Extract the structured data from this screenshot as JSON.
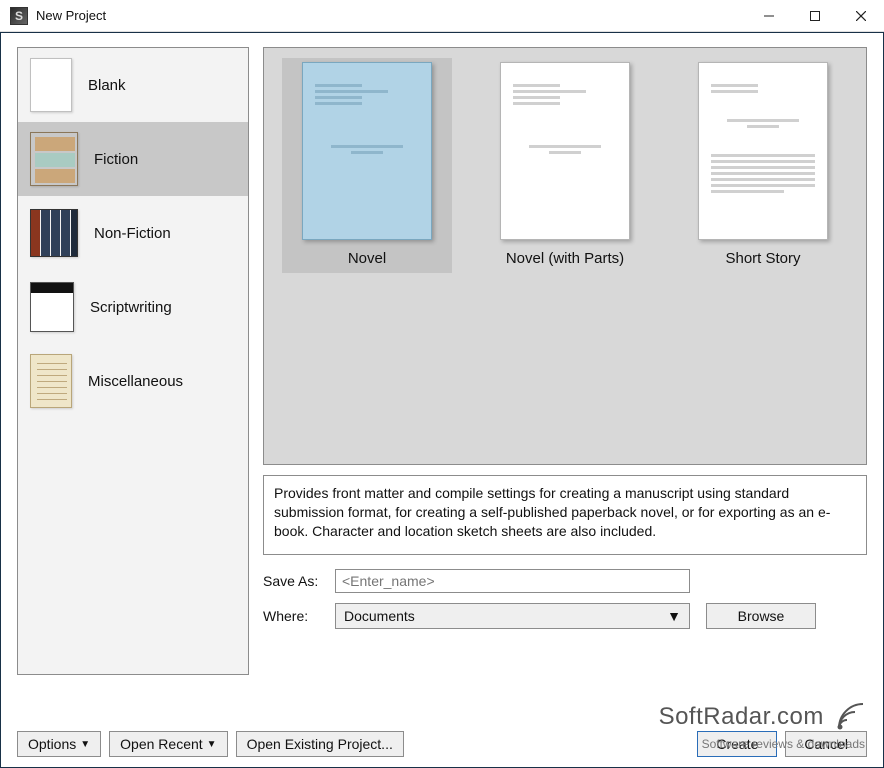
{
  "window": {
    "title": "New Project"
  },
  "categories": {
    "items": [
      {
        "label": "Blank",
        "selected": false,
        "icon": "blank"
      },
      {
        "label": "Fiction",
        "selected": true,
        "icon": "fiction"
      },
      {
        "label": "Non-Fiction",
        "selected": false,
        "icon": "books"
      },
      {
        "label": "Scriptwriting",
        "selected": false,
        "icon": "script"
      },
      {
        "label": "Miscellaneous",
        "selected": false,
        "icon": "misc"
      }
    ]
  },
  "templates": {
    "items": [
      {
        "label": "Novel",
        "selected": true
      },
      {
        "label": "Novel (with Parts)",
        "selected": false
      },
      {
        "label": "Short Story",
        "selected": false
      }
    ]
  },
  "description": "Provides front matter and compile settings for creating a manuscript using standard submission format, for creating a self-published paperback novel, or for exporting as an e-book. Character and location sketch sheets are also included.",
  "form": {
    "save_as_label": "Save As:",
    "save_as_placeholder": "<Enter_name>",
    "where_label": "Where:",
    "where_value": "Documents",
    "browse_label": "Browse"
  },
  "buttons": {
    "options": "Options",
    "open_recent": "Open Recent",
    "open_existing": "Open Existing Project...",
    "create": "Create",
    "cancel": "Cancel"
  },
  "watermark": {
    "line1": "SoftRadar.com",
    "line2": "Software reviews & downloads"
  }
}
